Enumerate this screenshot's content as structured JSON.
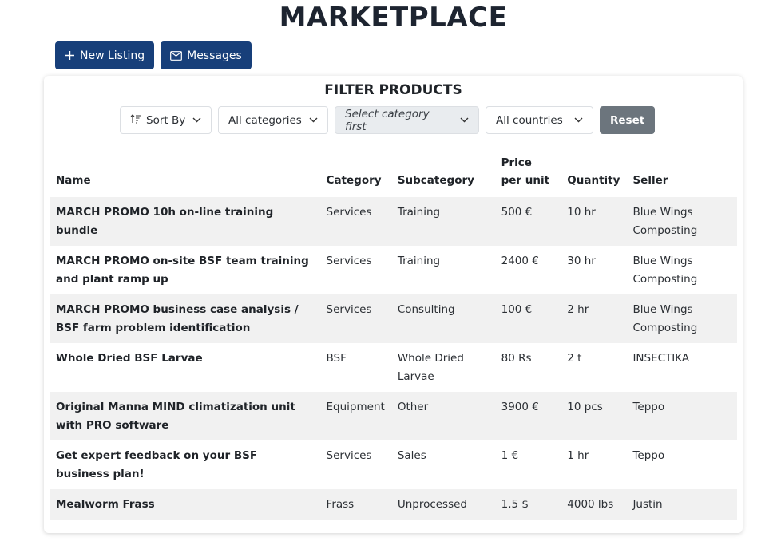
{
  "page": {
    "title": "MARKETPLACE"
  },
  "toolbar": {
    "new_listing_label": "New Listing",
    "messages_label": "Messages"
  },
  "filters": {
    "title": "FILTER PRODUCTS",
    "sort_label": "Sort By",
    "category_label": "All categories",
    "subcategory_label": "Select category first",
    "country_label": "All countries",
    "reset_label": "Reset"
  },
  "table": {
    "headers": {
      "name": "Name",
      "category": "Category",
      "subcategory": "Subcategory",
      "price": "Price per unit",
      "quantity": "Quantity",
      "seller": "Seller"
    },
    "rows": [
      {
        "name": "MARCH PROMO 10h on-line training bundle",
        "category": "Services",
        "subcategory": "Training",
        "price": "500 €",
        "quantity": "10 hr",
        "seller": "Blue Wings Composting"
      },
      {
        "name": "MARCH PROMO on-site BSF team training and plant ramp up",
        "category": "Services",
        "subcategory": "Training",
        "price": "2400 €",
        "quantity": "30 hr",
        "seller": "Blue Wings Composting"
      },
      {
        "name": "MARCH PROMO business case analysis / BSF farm problem identification",
        "category": "Services",
        "subcategory": "Consulting",
        "price": "100 €",
        "quantity": "2 hr",
        "seller": "Blue Wings Composting"
      },
      {
        "name": "Whole Dried BSF Larvae",
        "category": "BSF",
        "subcategory": "Whole Dried Larvae",
        "price": "80 Rs",
        "quantity": "2 t",
        "seller": "INSECTIKA"
      },
      {
        "name": "Original Manna MIND climatization unit with PRO software",
        "category": "Equipment",
        "subcategory": "Other",
        "price": "3900 €",
        "quantity": "10 pcs",
        "seller": "Teppo"
      },
      {
        "name": "Get expert feedback on your BSF business plan!",
        "category": "Services",
        "subcategory": "Sales",
        "price": "1 €",
        "quantity": "1 hr",
        "seller": "Teppo"
      },
      {
        "name": "Mealworm Frass",
        "category": "Frass",
        "subcategory": "Unprocessed",
        "price": "1.5 $",
        "quantity": "4000 lbs",
        "seller": "Justin"
      }
    ]
  },
  "colors": {
    "primary_button": "#173f7a",
    "reset_button": "#6c757d",
    "row_stripe": "#f1f1f1"
  },
  "icons": [
    "plus-icon",
    "envelope-icon",
    "sort-icon",
    "chevron-down-icon"
  ]
}
